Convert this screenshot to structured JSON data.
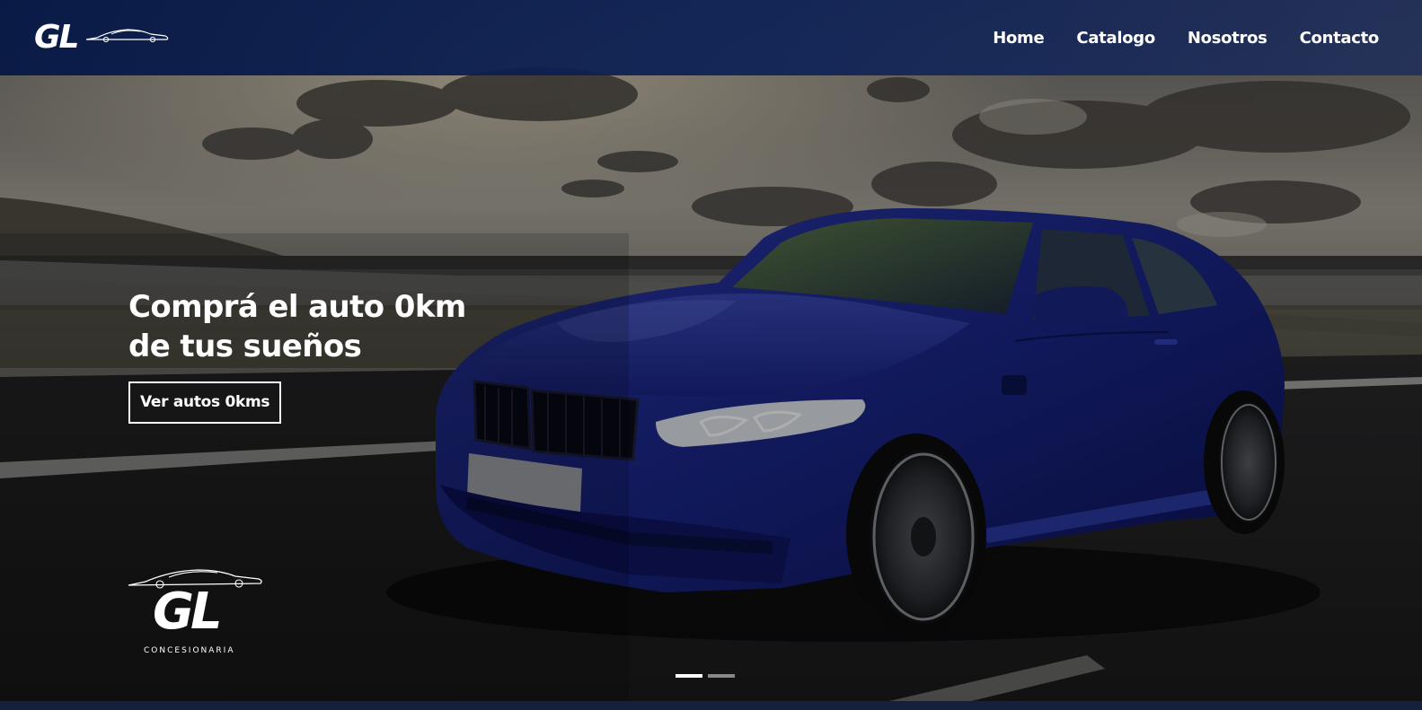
{
  "navbar": {
    "brand": "GL",
    "links": [
      {
        "label": "Home"
      },
      {
        "label": "Catalogo"
      },
      {
        "label": "Nosotros"
      },
      {
        "label": "Contacto"
      }
    ]
  },
  "hero": {
    "title_line1": "Comprá el auto 0km",
    "title_line2": "de tus sueños",
    "cta_label": "Ver autos 0kms"
  },
  "footer_logo": {
    "mark": "GL",
    "subtitle": "CONCESIONARIA"
  },
  "carousel": {
    "slide_count": 2,
    "active_index": 0
  },
  "colors": {
    "navbar": "#0d2256",
    "car_body": "#1c2a8c",
    "text": "#ffffff"
  },
  "icons": [
    "car-silhouette-icon"
  ]
}
